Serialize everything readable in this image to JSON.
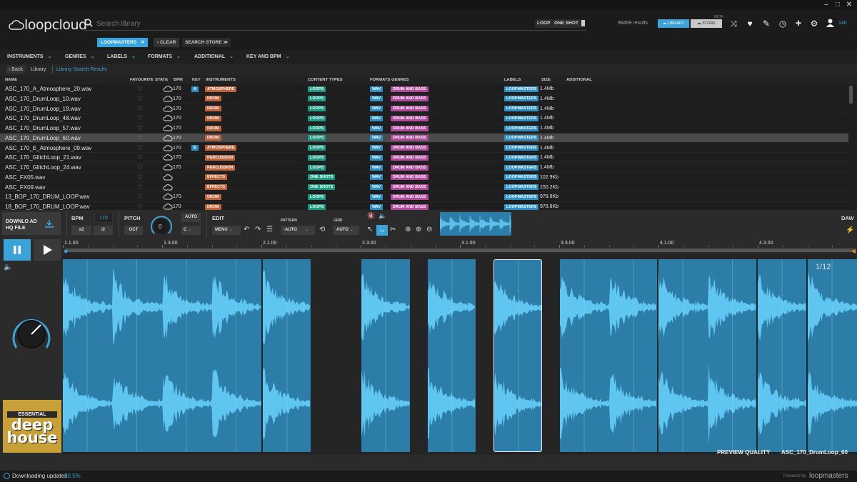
{
  "app": {
    "logo": "loopcloud"
  },
  "search": {
    "placeholder": "Search library",
    "loop_label": "LOOP",
    "oneshot_label": "ONE SHOT",
    "results": "98499 results"
  },
  "header": {
    "library_label": "LIBRARY",
    "store_label": "STORE",
    "store_badge": "BETA",
    "notifications": "140"
  },
  "tags": {
    "active_tag": "LOOPMASTERS",
    "clear_label": "CLEAR",
    "store_search_label": "SEARCH STORE"
  },
  "filters": [
    "INSTRUMENTS",
    "GENRES",
    "LABELS",
    "FORMATS",
    "ADDITIONAL",
    "KEY AND BPM"
  ],
  "breadcrumb": {
    "back": "Back",
    "library": "Library",
    "current": "Library Search Results"
  },
  "table": {
    "headers": {
      "name": "NAME",
      "favourite": "FAVOURITE",
      "state": "STATE",
      "bpm": "BPM",
      "key": "KEY",
      "instruments": "INSTRUMENTS",
      "content_types": "CONTENT TYPES",
      "formats": "FORMATS",
      "genres": "GENRES",
      "labels": "LABELS",
      "size": "SIZE",
      "additional": "ADDITIONAL"
    },
    "rows": [
      {
        "name": "ASC_170_A_Atmosphere_20.wav",
        "bpm": "170",
        "key": "A",
        "instrument": "ATMOSPHERE",
        "content": "LOOPS",
        "format": "WAV",
        "genre": "DRUM AND BASS",
        "label": "LOOPMASTERS",
        "size": "1.4Mb"
      },
      {
        "name": "ASC_170_DrumLoop_10.wav",
        "bpm": "170",
        "key": "",
        "instrument": "DRUM",
        "content": "LOOPS",
        "format": "WAV",
        "genre": "DRUM AND BASS",
        "label": "LOOPMASTERS",
        "size": "1.4Mb"
      },
      {
        "name": "ASC_170_DrumLoop_19.wav",
        "bpm": "170",
        "key": "",
        "instrument": "DRUM",
        "content": "LOOPS",
        "format": "WAV",
        "genre": "DRUM AND BASS",
        "label": "LOOPMASTERS",
        "size": "1.4Mb"
      },
      {
        "name": "ASC_170_DrumLoop_48.wav",
        "bpm": "170",
        "key": "",
        "instrument": "DRUM",
        "content": "LOOPS",
        "format": "WAV",
        "genre": "DRUM AND BASS",
        "label": "LOOPMASTERS",
        "size": "1.4Mb"
      },
      {
        "name": "ASC_170_DrumLoop_57.wav",
        "bpm": "170",
        "key": "",
        "instrument": "DRUM",
        "content": "LOOPS",
        "format": "WAV",
        "genre": "DRUM AND BASS",
        "label": "LOOPMASTERS",
        "size": "1.4Mb"
      },
      {
        "name": "ASC_170_DrumLoop_60.wav",
        "bpm": "170",
        "key": "",
        "instrument": "DRUM",
        "content": "LOOPS",
        "format": "WAV",
        "genre": "DRUM AND BASS",
        "label": "LOOPMASTERS",
        "size": "1.4Mb"
      },
      {
        "name": "ASC_170_E_Atmosphere_09.wav",
        "bpm": "170",
        "key": "E",
        "instrument": "ATMOSPHERE",
        "content": "LOOPS",
        "format": "WAV",
        "genre": "DRUM AND BASS",
        "label": "LOOPMASTERS",
        "size": "1.4Mb"
      },
      {
        "name": "ASC_170_GlitchLoop_21.wav",
        "bpm": "170",
        "key": "",
        "instrument": "PERCUSSION",
        "content": "LOOPS",
        "format": "WAV",
        "genre": "DRUM AND BASS",
        "label": "LOOPMASTERS",
        "size": "1.4Mb"
      },
      {
        "name": "ASC_170_GlitchLoop_24.wav",
        "bpm": "170",
        "key": "",
        "instrument": "PERCUSSION",
        "content": "LOOPS",
        "format": "WAV",
        "genre": "DRUM AND BASS",
        "label": "LOOPMASTERS",
        "size": "1.4Mb"
      },
      {
        "name": "ASC_FX05.wav",
        "bpm": "",
        "key": "",
        "instrument": "EFFECTS",
        "content": "ONE SHOTS",
        "format": "WAV",
        "genre": "DRUM AND BASS",
        "label": "LOOPMASTERS",
        "size": "102.9Kb"
      },
      {
        "name": "ASC_FX09.wav",
        "bpm": "",
        "key": "",
        "instrument": "EFFECTS",
        "content": "ONE SHOTS",
        "format": "WAV",
        "genre": "DRUM AND BASS",
        "label": "LOOPMASTERS",
        "size": "150.2Kb"
      },
      {
        "name": "13_BOP_170_DRUM_LOOP.wav",
        "bpm": "170",
        "key": "",
        "instrument": "DRUM",
        "content": "LOOPS",
        "format": "WAV",
        "genre": "DRUM AND BASS",
        "label": "LOOPMASTERS",
        "size": "978.8Kb"
      },
      {
        "name": "18_BOP_170_DRUM_LOOP.wav",
        "bpm": "170",
        "key": "",
        "instrument": "DRUM",
        "content": "LOOPS",
        "format": "WAV",
        "genre": "DRUM AND BASS",
        "label": "LOOPMASTERS",
        "size": "978.8Kb"
      }
    ],
    "selected_index": 5
  },
  "player": {
    "download_label": "DOWNLO AD HQ FILE",
    "bpm_label": "BPM",
    "bpm_value": "170",
    "x2": "x2",
    "div2": "/2",
    "pitch_label": "PITCH",
    "oct_label": "OCT",
    "pitch_value": "0",
    "auto_label": "AUTO",
    "key_value": "C",
    "edit_label": "EDIT",
    "menu_label": "MENU",
    "pattern_label": "PATTERN",
    "pattern_value": "-AUTO",
    "grid_label": "GRID",
    "grid_value": "AUTO",
    "daw_label": "DAW",
    "ruler": [
      "1.1.00",
      "1.3.00",
      "2.1.00",
      "2.3.00",
      "3.1.00",
      "3.3.00",
      "4.1.00",
      "4.3.00"
    ],
    "slice_indicator": "1/12",
    "quality": "PREVIEW QUALITY",
    "file": "ASC_170_DrumLoop_60",
    "cover": {
      "top": "ESSENTIAL",
      "title": "deep house"
    }
  },
  "status": {
    "text": "Downloading updates",
    "percent": "20.5%",
    "powered": "Powered by",
    "brand": "loopmasters"
  },
  "colors": {
    "accent": "#3aa4da",
    "instrument": "#c0623a",
    "content": "#1f9a82",
    "genre": "#b04a9c",
    "wave": "#2c7ea8"
  }
}
